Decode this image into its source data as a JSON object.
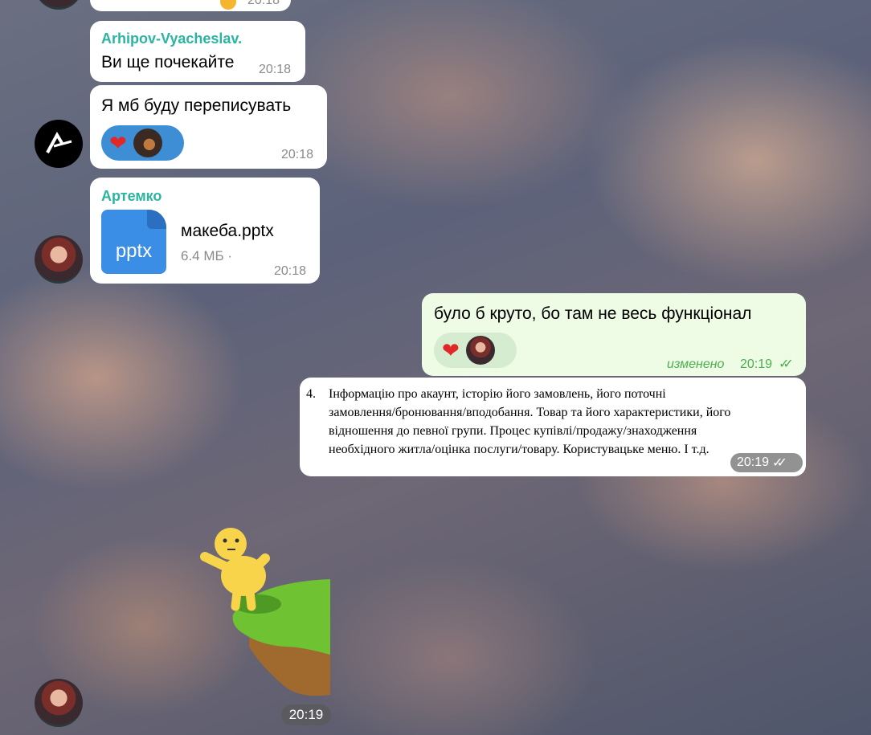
{
  "messages": {
    "top_partial": {
      "time": "20:18"
    },
    "m1": {
      "sender": "Arhipov-Vyacheslav.",
      "text": "Ви ще почекайте",
      "time": "20:18"
    },
    "m2": {
      "text": "Я мб буду переписувать",
      "time": "20:18"
    },
    "m3": {
      "sender": "Артемко",
      "file_icon": "pptx",
      "file_name": "макеба.pptx",
      "file_meta": "6.4 МБ ·",
      "time": "20:18"
    },
    "m4": {
      "text": "було б круто, бо там не весь функціонал",
      "edited": "изменено",
      "time": "20:19"
    },
    "m5": {
      "number": "4.",
      "lines": [
        "Інформацію про акаунт, історію його замовлень, його поточні",
        "замовлення/бронювання/вподобання. Товар та його характеристики, його",
        "відношення до певної групи. Процес купівлі/продажу/знаходження",
        "необхідного житла/оцінка послуги/товару. Користувацьке меню. І т.д."
      ],
      "time": "20:19"
    },
    "m6": {
      "time": "20:19"
    }
  },
  "colors": {
    "sender": "#2ab5a0",
    "outgoing": "#eefbe5",
    "check": "#4caf50"
  }
}
